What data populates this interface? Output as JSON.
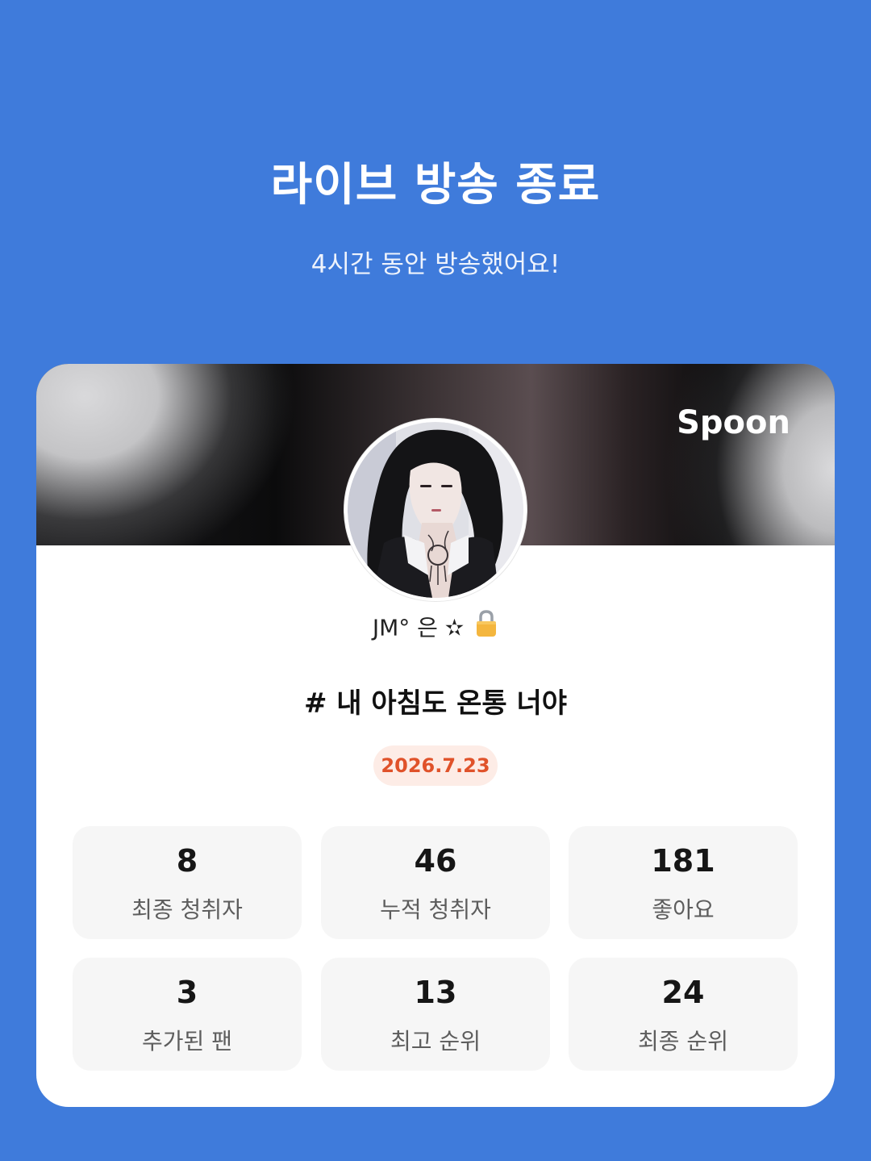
{
  "header": {
    "title": "라이브 방송 종료",
    "subtitle": "4시간 동안 방송했어요!"
  },
  "card": {
    "brand": "Spoon",
    "username": "JM° 은 ✫",
    "lock_icon": "lock-icon",
    "room_title": "# 내 아침도 온통 너야",
    "date": "2026.7.23"
  },
  "stats": [
    {
      "value": "8",
      "label": "최종 청취자"
    },
    {
      "value": "46",
      "label": "누적 청취자"
    },
    {
      "value": "181",
      "label": "좋아요"
    },
    {
      "value": "3",
      "label": "추가된 팬"
    },
    {
      "value": "13",
      "label": "최고 순위"
    },
    {
      "value": "24",
      "label": "최종 순위"
    }
  ],
  "colors": {
    "background": "#3F7BDB",
    "card": "#FFFFFF",
    "date_text": "#E0522A",
    "date_badge": "#FDECE6",
    "stat_bg": "#F6F6F6"
  }
}
